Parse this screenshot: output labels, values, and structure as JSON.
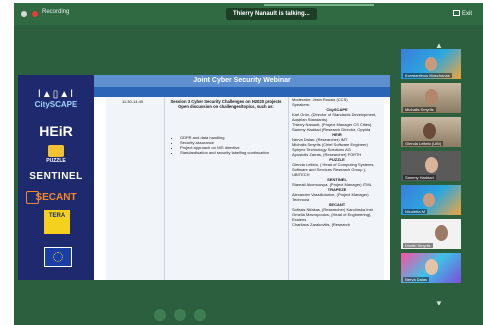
{
  "topbar": {
    "recording_label": "Recording",
    "talking_text": "Thierry Nanault is talking...",
    "exit_label": "Exit"
  },
  "slide": {
    "title": "Joint Cyber Security Webinar",
    "logos": {
      "citymark": "Ⅰ▲▯▲Ⅰ",
      "city": "CitySCAPE",
      "heir": "HEiR",
      "puzzle": "PUZZLE",
      "sentinel": "SENTINEL",
      "secant": "SECANT",
      "tera": "TERA"
    },
    "schedule": {
      "time": "11:30-14:45",
      "session_title": "Session 3 Cyber Security Challenges on H2020 projects Open discussion on challenges/topics, such as:",
      "topics": [
        "GDPR and data handling",
        "Security assurance",
        "Project approach on NIS directive",
        "Standardisation and security labelling continuation"
      ],
      "speakers": [
        {
          "text": "Moderator: Jesin Rouaiz (CCS)",
          "org": false
        },
        {
          "text": "Speakers:",
          "org": false
        },
        {
          "text": "CitySCAPE",
          "org": true
        },
        {
          "text": "Karl Grün, (Director of Standards Development, Austrian Standards)",
          "org": false
        },
        {
          "text": "Thierry Nanault, (Project Manager CS Cities)",
          "org": false
        },
        {
          "text": "Sammy Haddad (Research Director, Oppida",
          "org": false
        },
        {
          "text": "HEiR",
          "org": true
        },
        {
          "text": "Nerva Dalas: (Researcher) IMT",
          "org": false
        },
        {
          "text": "Michalis Smyrlis (Chief Software Engineer) Sphynx Technology Solutions AG",
          "org": false
        },
        {
          "text": "Apostolis Zarras, (Researcher) FORTH",
          "org": false
        },
        {
          "text": "PUZZLE",
          "org": true
        },
        {
          "text": "Glenda Leitelo, ( Head of Computing Systems, Software and Services Research Group ), UBITECH",
          "org": false
        },
        {
          "text": "SENTINEL",
          "org": true
        },
        {
          "text": "Stamati Akomousya, (Project Manager) ITML",
          "org": false
        },
        {
          "text": "TRAPEZE",
          "org": true
        },
        {
          "text": "Alexander Vassiliotorice, (Project Manager) Technova",
          "org": false
        },
        {
          "text": "SECANT",
          "org": true
        },
        {
          "text": "Sotirais Nifakas, (Researcher) Karolinska Inst",
          "org": false
        },
        {
          "text": "Ornella Mavropoulos, (Head of Engineering), Exalens",
          "org": false
        },
        {
          "text": "Charilaos Zarakovitis, (Research",
          "org": false
        }
      ]
    }
  },
  "participants": [
    {
      "name": "Konstantinos Moschonas",
      "style": "t-blue"
    },
    {
      "name": "Michalis Smyrlis",
      "style": "t-room"
    },
    {
      "name": "Glenda Leitelo (UBI)",
      "style": "t-room"
    },
    {
      "name": "Sammy Haddad",
      "style": "t-dark"
    },
    {
      "name": "Nicoletta M",
      "style": "t-blue"
    },
    {
      "name": "Dimitri Smyrlis",
      "style": "t-white"
    },
    {
      "name": "Nerva Dalas",
      "style": "t-color"
    }
  ]
}
